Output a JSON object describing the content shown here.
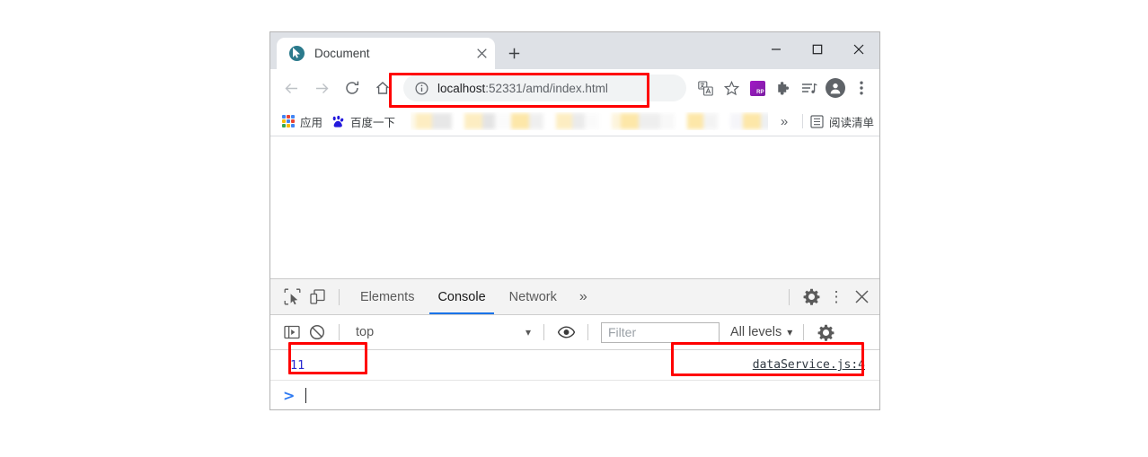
{
  "browser": {
    "tab": {
      "title": "Document",
      "favicon_name": "live-server-cursor-icon",
      "close_label": "×"
    },
    "newtab_label": "+",
    "window_controls": {
      "minimize": "—",
      "maximize": "□",
      "close": "✕"
    },
    "toolbar": {
      "back_label": "←",
      "forward_label": "→",
      "reload_label": "C",
      "home_label": "⌂",
      "url_host": "localhost",
      "url_path": ":52331/amd/index.html",
      "url_full": "localhost:52331/amd/index.html",
      "site_info_label": "ⓘ",
      "translate_label": "translate-icon",
      "bookmark_star_label": "☆",
      "extension_rp_label": "RP",
      "extensions_label": "puzzle-icon",
      "media_label": "media-icon",
      "profile_label": "profile-icon",
      "menu_label": "⋮"
    },
    "bookmarks": {
      "apps_label": "应用",
      "baidu_label": "百度一下",
      "overflow_label": "»",
      "reading_list_label": "阅读清单"
    }
  },
  "devtools": {
    "inspect_label": "inspect-element-icon",
    "device_label": "device-toolbar-icon",
    "tabs": [
      {
        "label": "Elements",
        "active": false
      },
      {
        "label": "Console",
        "active": true
      },
      {
        "label": "Network",
        "active": false
      }
    ],
    "more_tabs_label": "»",
    "settings_label": "gear-icon",
    "menu_label": "⋮",
    "close_label": "✕",
    "filterbar": {
      "sidebar_toggle_label": "console-sidebar-icon",
      "clear_label": "clear-console-icon",
      "context_value": "top",
      "context_caret": "▾",
      "eye_label": "live-expression-icon",
      "filter_placeholder": "Filter",
      "levels_value": "All levels",
      "levels_caret": "▾",
      "settings_label": "gear-icon"
    },
    "console": {
      "messages": [
        {
          "value": "11",
          "source": "dataService.js:4"
        }
      ],
      "prompt_arrow": ">"
    }
  },
  "annotations": {
    "accent_color": "#ff0000",
    "boxes": [
      {
        "name": "url-highlight"
      },
      {
        "name": "console-value-highlight"
      },
      {
        "name": "console-source-highlight"
      }
    ]
  },
  "colors": {
    "tabstrip_bg": "#dee1e6",
    "omnibox_bg": "#f1f3f4",
    "devtools_bg": "#f3f3f3",
    "active_tab_underline": "#1a73e8",
    "console_value": "#2a2ad0",
    "prompt_blue": "#2e7af2"
  }
}
